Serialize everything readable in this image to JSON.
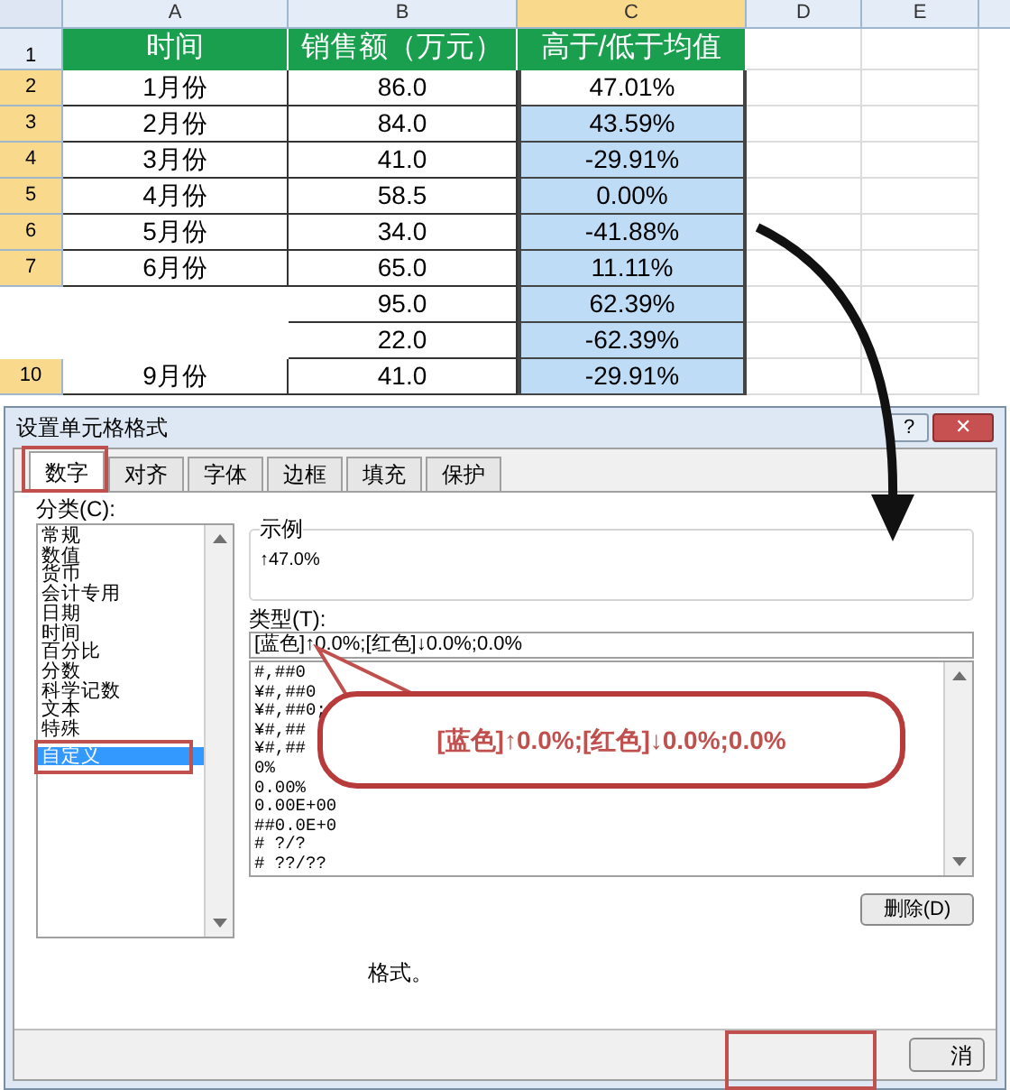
{
  "sheet": {
    "columns": [
      "A",
      "B",
      "C",
      "D",
      "E"
    ],
    "header": {
      "number": "1",
      "cells": [
        "时间",
        "销售额（万元）",
        "高于/低于均值"
      ]
    },
    "rows": [
      {
        "number": "2",
        "time": "1月份",
        "sales": "86.0",
        "vs_average": "47.01%",
        "selected": false
      },
      {
        "number": "3",
        "time": "2月份",
        "sales": "84.0",
        "vs_average": "43.59%",
        "selected": true
      },
      {
        "number": "4",
        "time": "3月份",
        "sales": "41.0",
        "vs_average": "-29.91%",
        "selected": true
      },
      {
        "number": "5",
        "time": "4月份",
        "sales": "58.5",
        "vs_average": "0.00%",
        "selected": true
      },
      {
        "number": "6",
        "time": "5月份",
        "sales": "34.0",
        "vs_average": "-41.88%",
        "selected": true
      },
      {
        "number": "7",
        "time": "6月份",
        "sales": "65.0",
        "vs_average": "11.11%",
        "selected": true
      },
      {
        "sales": "95.0",
        "vs_average": "62.39%",
        "selected": true
      },
      {
        "sales": "22.0",
        "vs_average": "-62.39%",
        "selected": true
      },
      {
        "number": "10",
        "time": "9月份",
        "sales": "41.0",
        "vs_average": "-29.91%",
        "selected": true
      }
    ]
  },
  "dialog": {
    "title": "设置单元格格式",
    "help": "?",
    "close": "✕",
    "tabs": [
      {
        "label": "数字",
        "selected": true
      },
      {
        "label": "对齐",
        "selected": false
      },
      {
        "label": "字体",
        "selected": false
      },
      {
        "label": "边框",
        "selected": false
      },
      {
        "label": "填充",
        "selected": false
      },
      {
        "label": "保护",
        "selected": false
      }
    ],
    "category_label": "分类(C):",
    "categories": [
      {
        "label": "常规",
        "selected": false
      },
      {
        "label": "数值",
        "selected": false
      },
      {
        "label": "货币",
        "selected": false
      },
      {
        "label": "会计专用",
        "selected": false
      },
      {
        "label": "日期",
        "selected": false
      },
      {
        "label": "时间",
        "selected": false
      },
      {
        "label": "百分比",
        "selected": false
      },
      {
        "label": "分数",
        "selected": false
      },
      {
        "label": "科学记数",
        "selected": false
      },
      {
        "label": "文本",
        "selected": false
      },
      {
        "label": "特殊",
        "selected": false
      },
      {
        "label": "自定义",
        "selected": true
      }
    ],
    "sample_label": "示例",
    "sample_value": "↑47.0%",
    "type_label": "类型(T):",
    "type_value": "[蓝色]↑0.0%;[红色]↓0.0%;0.0%",
    "formats": [
      "#,##0",
      "¥#,##0",
      "¥#,##0;",
      "¥#,##",
      "¥#,##",
      "0%",
      "0.00%",
      "0.00E+00",
      "##0.0E+0",
      "# ?/?",
      "# ??/??"
    ],
    "delete_button": "删除(D)",
    "description": "格式。",
    "cancel_button": "消"
  },
  "callout": {
    "text": "[蓝色]↑0.0%;[红色]↓0.0%;0.0%"
  }
}
